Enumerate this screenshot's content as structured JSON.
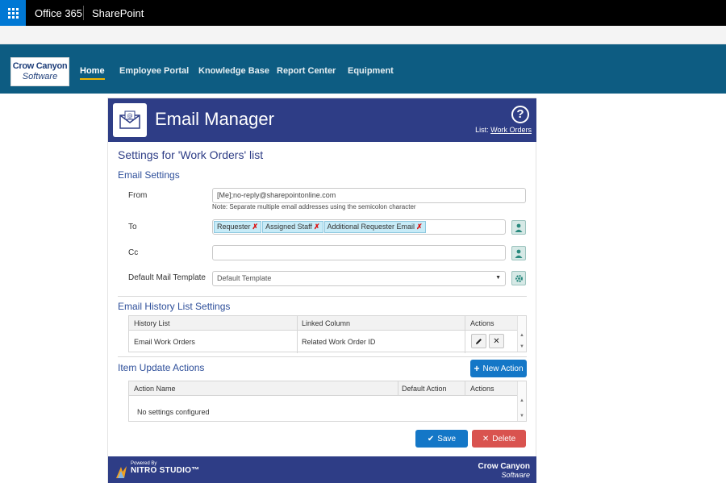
{
  "o365": {
    "app": "Office 365",
    "site": "SharePoint"
  },
  "nav": {
    "logo": {
      "line1": "Crow Canyon",
      "line2": "Software"
    },
    "items": [
      "Home",
      "Employee Portal",
      "Knowledge Base",
      "Report Center",
      "Equipment"
    ],
    "active": "Home",
    "accent": "#f0b400"
  },
  "card": {
    "title": "Email Manager",
    "list_label": "List:",
    "list_name": "Work Orders",
    "settings_heading": "Settings for 'Work Orders' list",
    "email_settings": {
      "heading": "Email Settings",
      "from_label": "From",
      "from_value": "[Me];no-reply@sharepointonline.com",
      "from_note": "Note: Separate multiple email addresses using the semicolon character",
      "to_label": "To",
      "to_tokens": [
        "Requester",
        "Assigned Staff",
        "Additional Requester Email"
      ],
      "token_remove": "✗",
      "cc_label": "Cc",
      "cc_value": "",
      "template_label": "Default Mail Template",
      "template_value": "Default Template"
    },
    "history": {
      "heading": "Email History List Settings",
      "columns": [
        "History List",
        "Linked Column",
        "Actions"
      ],
      "rows": [
        {
          "list": "Email Work Orders",
          "column": "Related Work Order ID"
        }
      ]
    },
    "item_actions": {
      "heading": "Item Update Actions",
      "new_action": "New Action",
      "columns": [
        "Action Name",
        "Default Action",
        "Actions"
      ],
      "empty": "No settings configured"
    },
    "buttons": {
      "save": "Save",
      "delete": "Delete"
    },
    "footer": {
      "powered_by": "Powered By",
      "nitro": "NITRO STUDIO™",
      "logo1": "Crow Canyon",
      "logo2": "Software"
    }
  },
  "colors": {
    "header": "#2e3d86",
    "nav": "#0d5c82",
    "primary": "#1477c7",
    "danger": "#d9534f"
  }
}
